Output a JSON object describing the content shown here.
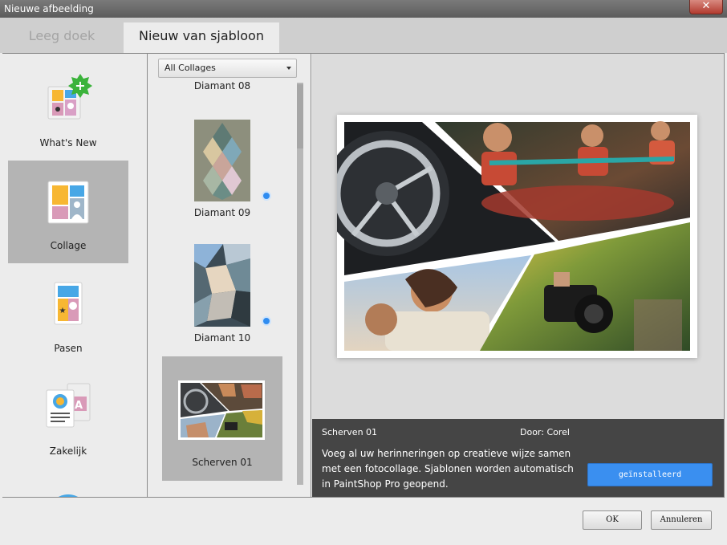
{
  "window": {
    "title": "Nieuwe afbeelding",
    "close_glyph": "✕"
  },
  "tabs": [
    {
      "label": "Leeg doek",
      "active": false
    },
    {
      "label": "Nieuw van sjabloon",
      "active": true
    }
  ],
  "categories": [
    {
      "label": "What's New",
      "icon": "new-star-icon"
    },
    {
      "label": "Collage",
      "icon": "collage-icon",
      "selected": true
    },
    {
      "label": "Pasen",
      "icon": "easter-card-icon"
    },
    {
      "label": "Zakelijk",
      "icon": "business-docs-icon"
    },
    {
      "label": "",
      "icon": "round-category-icon"
    }
  ],
  "templates": {
    "filter": "All Collages",
    "items": [
      {
        "label": "Diamant 08"
      },
      {
        "label": "Diamant 09",
        "downloadable": true
      },
      {
        "label": "Diamant 10",
        "downloadable": true
      },
      {
        "label": "Scherven 01",
        "selected": true
      }
    ]
  },
  "details": {
    "name": "Scherven 01",
    "author": "Door: Corel",
    "description": "Voeg al uw herinneringen op creatieve wijze samen met een fotocollage. Sjablonen worden automatisch in PaintShop Pro geopend.",
    "install_label": "geïnstalleerd"
  },
  "footer": {
    "ok_label": "OK",
    "cancel_label": "Annuleren"
  },
  "colors": {
    "accent": "#3a8ff0",
    "selected_bg": "#b4b4b4",
    "info_bg": "#454545"
  }
}
